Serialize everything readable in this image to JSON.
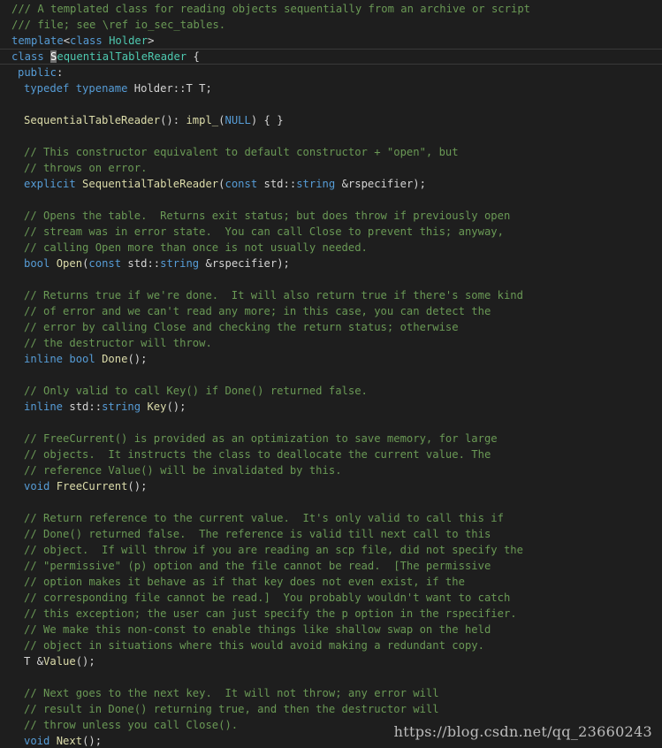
{
  "editor": {
    "lines": [
      {
        "indent": 0,
        "tokens": [
          {
            "c": "comment",
            "t": "/// A templated class for reading objects sequentially from an archive or script"
          }
        ]
      },
      {
        "indent": 0,
        "tokens": [
          {
            "c": "comment",
            "t": "/// file; see \\ref io_sec_tables."
          }
        ]
      },
      {
        "indent": 0,
        "tokens": [
          {
            "c": "kw",
            "t": "template"
          },
          {
            "c": "plain",
            "t": "<"
          },
          {
            "c": "kw",
            "t": "class"
          },
          {
            "c": "plain",
            "t": " "
          },
          {
            "c": "type",
            "t": "Holder"
          },
          {
            "c": "plain",
            "t": ">"
          }
        ]
      },
      {
        "indent": 0,
        "cursor": true,
        "tokens": [
          {
            "c": "kw",
            "t": "class"
          },
          {
            "c": "plain",
            "t": " "
          },
          {
            "c": "cursor",
            "t": "S"
          },
          {
            "c": "type",
            "t": "equentialTableReader"
          },
          {
            "c": "plain",
            "t": " {"
          }
        ]
      },
      {
        "indent": 1,
        "tokens": [
          {
            "c": "kw",
            "t": "public"
          },
          {
            "c": "plain",
            "t": ":"
          }
        ]
      },
      {
        "indent": 2,
        "tokens": [
          {
            "c": "kw",
            "t": "typedef"
          },
          {
            "c": "plain",
            "t": " "
          },
          {
            "c": "kw",
            "t": "typename"
          },
          {
            "c": "plain",
            "t": " Holder::T T;"
          }
        ]
      },
      {
        "indent": 2,
        "tokens": []
      },
      {
        "indent": 2,
        "tokens": [
          {
            "c": "fn",
            "t": "SequentialTableReader"
          },
          {
            "c": "plain",
            "t": "(): "
          },
          {
            "c": "fn",
            "t": "impl_"
          },
          {
            "c": "plain",
            "t": "("
          },
          {
            "c": "const",
            "t": "NULL"
          },
          {
            "c": "plain",
            "t": ") { }"
          }
        ]
      },
      {
        "indent": 2,
        "tokens": []
      },
      {
        "indent": 2,
        "tokens": [
          {
            "c": "comment",
            "t": "// This constructor equivalent to default constructor + \"open\", but"
          }
        ]
      },
      {
        "indent": 2,
        "tokens": [
          {
            "c": "comment",
            "t": "// throws on error."
          }
        ]
      },
      {
        "indent": 2,
        "tokens": [
          {
            "c": "kw",
            "t": "explicit"
          },
          {
            "c": "plain",
            "t": " "
          },
          {
            "c": "fn",
            "t": "SequentialTableReader"
          },
          {
            "c": "plain",
            "t": "("
          },
          {
            "c": "kw",
            "t": "const"
          },
          {
            "c": "plain",
            "t": " std::"
          },
          {
            "c": "kw",
            "t": "string"
          },
          {
            "c": "plain",
            "t": " &rspecifier);"
          }
        ]
      },
      {
        "indent": 2,
        "tokens": []
      },
      {
        "indent": 2,
        "tokens": [
          {
            "c": "comment",
            "t": "// Opens the table.  Returns exit status; but does throw if previously open"
          }
        ]
      },
      {
        "indent": 2,
        "tokens": [
          {
            "c": "comment",
            "t": "// stream was in error state.  You can call Close to prevent this; anyway,"
          }
        ]
      },
      {
        "indent": 2,
        "tokens": [
          {
            "c": "comment",
            "t": "// calling Open more than once is not usually needed."
          }
        ]
      },
      {
        "indent": 2,
        "tokens": [
          {
            "c": "kw",
            "t": "bool"
          },
          {
            "c": "plain",
            "t": " "
          },
          {
            "c": "fn",
            "t": "Open"
          },
          {
            "c": "plain",
            "t": "("
          },
          {
            "c": "kw",
            "t": "const"
          },
          {
            "c": "plain",
            "t": " std::"
          },
          {
            "c": "kw",
            "t": "string"
          },
          {
            "c": "plain",
            "t": " &rspecifier);"
          }
        ]
      },
      {
        "indent": 2,
        "tokens": []
      },
      {
        "indent": 2,
        "tokens": [
          {
            "c": "comment",
            "t": "// Returns true if we're done.  It will also return true if there's some kind"
          }
        ]
      },
      {
        "indent": 2,
        "tokens": [
          {
            "c": "comment",
            "t": "// of error and we can't read any more; in this case, you can detect the"
          }
        ]
      },
      {
        "indent": 2,
        "tokens": [
          {
            "c": "comment",
            "t": "// error by calling Close and checking the return status; otherwise"
          }
        ]
      },
      {
        "indent": 2,
        "tokens": [
          {
            "c": "comment",
            "t": "// the destructor will throw."
          }
        ]
      },
      {
        "indent": 2,
        "tokens": [
          {
            "c": "kw",
            "t": "inline"
          },
          {
            "c": "plain",
            "t": " "
          },
          {
            "c": "kw",
            "t": "bool"
          },
          {
            "c": "plain",
            "t": " "
          },
          {
            "c": "fn",
            "t": "Done"
          },
          {
            "c": "plain",
            "t": "();"
          }
        ]
      },
      {
        "indent": 2,
        "tokens": []
      },
      {
        "indent": 2,
        "tokens": [
          {
            "c": "comment",
            "t": "// Only valid to call Key() if Done() returned false."
          }
        ]
      },
      {
        "indent": 2,
        "tokens": [
          {
            "c": "kw",
            "t": "inline"
          },
          {
            "c": "plain",
            "t": " std::"
          },
          {
            "c": "kw",
            "t": "string"
          },
          {
            "c": "plain",
            "t": " "
          },
          {
            "c": "fn",
            "t": "Key"
          },
          {
            "c": "plain",
            "t": "();"
          }
        ]
      },
      {
        "indent": 2,
        "tokens": []
      },
      {
        "indent": 2,
        "tokens": [
          {
            "c": "comment",
            "t": "// FreeCurrent() is provided as an optimization to save memory, for large"
          }
        ]
      },
      {
        "indent": 2,
        "tokens": [
          {
            "c": "comment",
            "t": "// objects.  It instructs the class to deallocate the current value. The"
          }
        ]
      },
      {
        "indent": 2,
        "tokens": [
          {
            "c": "comment",
            "t": "// reference Value() will be invalidated by this."
          }
        ]
      },
      {
        "indent": 2,
        "tokens": [
          {
            "c": "kw",
            "t": "void"
          },
          {
            "c": "plain",
            "t": " "
          },
          {
            "c": "fn",
            "t": "FreeCurrent"
          },
          {
            "c": "plain",
            "t": "();"
          }
        ]
      },
      {
        "indent": 2,
        "tokens": []
      },
      {
        "indent": 2,
        "tokens": [
          {
            "c": "comment",
            "t": "// Return reference to the current value.  It's only valid to call this if"
          }
        ]
      },
      {
        "indent": 2,
        "tokens": [
          {
            "c": "comment",
            "t": "// Done() returned false.  The reference is valid till next call to this"
          }
        ]
      },
      {
        "indent": 2,
        "tokens": [
          {
            "c": "comment",
            "t": "// object.  If will throw if you are reading an scp file, did not specify the"
          }
        ]
      },
      {
        "indent": 2,
        "tokens": [
          {
            "c": "comment",
            "t": "// \"permissive\" (p) option and the file cannot be read.  [The permissive"
          }
        ]
      },
      {
        "indent": 2,
        "tokens": [
          {
            "c": "comment",
            "t": "// option makes it behave as if that key does not even exist, if the"
          }
        ]
      },
      {
        "indent": 2,
        "tokens": [
          {
            "c": "comment",
            "t": "// corresponding file cannot be read.]  You probably wouldn't want to catch"
          }
        ]
      },
      {
        "indent": 2,
        "tokens": [
          {
            "c": "comment",
            "t": "// this exception; the user can just specify the p option in the rspecifier."
          }
        ]
      },
      {
        "indent": 2,
        "tokens": [
          {
            "c": "comment",
            "t": "// We make this non-const to enable things like shallow swap on the held"
          }
        ]
      },
      {
        "indent": 2,
        "tokens": [
          {
            "c": "comment",
            "t": "// object in situations where this would avoid making a redundant copy."
          }
        ]
      },
      {
        "indent": 2,
        "tokens": [
          {
            "c": "plain",
            "t": "T &"
          },
          {
            "c": "fn",
            "t": "Value"
          },
          {
            "c": "plain",
            "t": "();"
          }
        ]
      },
      {
        "indent": 2,
        "tokens": []
      },
      {
        "indent": 2,
        "tokens": [
          {
            "c": "comment",
            "t": "// Next goes to the next key.  It will not throw; any error will"
          }
        ]
      },
      {
        "indent": 2,
        "tokens": [
          {
            "c": "comment",
            "t": "// result in Done() returning true, and then the destructor will"
          }
        ]
      },
      {
        "indent": 2,
        "tokens": [
          {
            "c": "comment",
            "t": "// throw unless you call Close()."
          }
        ]
      },
      {
        "indent": 2,
        "tokens": [
          {
            "c": "kw",
            "t": "void"
          },
          {
            "c": "plain",
            "t": " "
          },
          {
            "c": "fn",
            "t": "Next"
          },
          {
            "c": "plain",
            "t": "();"
          }
        ]
      }
    ]
  },
  "watermark": {
    "text": "https://blog.csdn.net/qq_23660243"
  },
  "colors": {
    "background": "#1e1e1e",
    "comment": "#6a9955",
    "keyword": "#569cd6",
    "type": "#4ec9b0",
    "function": "#dcdcaa",
    "plain": "#d4d4d4"
  }
}
